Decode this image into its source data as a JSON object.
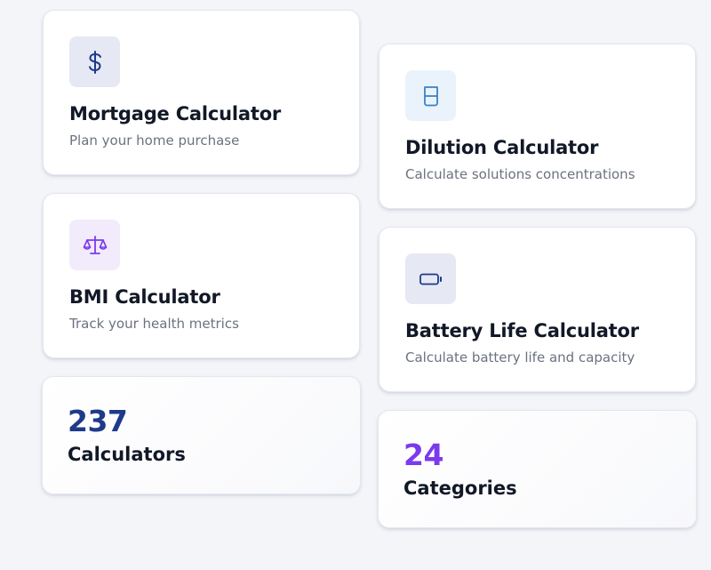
{
  "calculators": [
    {
      "title": "Mortgage Calculator",
      "description": "Plan your home purchase",
      "icon": "dollar-icon",
      "icon_color": "#1e3a8a",
      "icon_bg": "#e6e8f4"
    },
    {
      "title": "BMI Calculator",
      "description": "Track your health metrics",
      "icon": "scale-icon",
      "icon_color": "#7c3aed",
      "icon_bg": "#f1ebfb"
    },
    {
      "title": "Dilution Calculator",
      "description": "Calculate solutions concentrations",
      "icon": "beaker-icon",
      "icon_color": "#3b82c4",
      "icon_bg": "#eaf3fb"
    },
    {
      "title": "Battery Life Calculator",
      "description": "Calculate battery life and capacity",
      "icon": "battery-icon",
      "icon_color": "#1e3a8a",
      "icon_bg": "#e6e8f4"
    }
  ],
  "stats": [
    {
      "value": "237",
      "label": "Calculators",
      "color": "#1e3a8a"
    },
    {
      "value": "24",
      "label": "Categories",
      "color": "#7c3aed"
    }
  ]
}
